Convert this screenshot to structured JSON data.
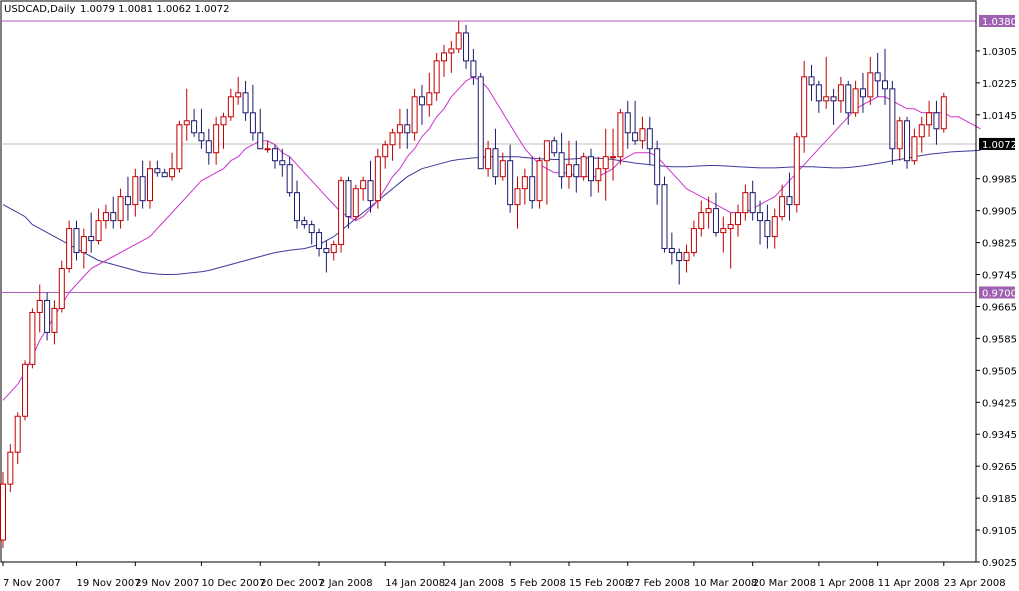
{
  "header": {
    "symbol": "USDCAD,Daily",
    "ohlc": "1.0079 1.0081 1.0062 1.0072"
  },
  "colors": {
    "background": "#ffffff",
    "bull_candle": "#c00000",
    "bear_candle": "#1a1a6e",
    "fast_ma": "#cc33cc",
    "slow_ma": "#3c3c9c",
    "level_line": "#b060c0",
    "level_badge": "#a060b0",
    "price_line": "#c0c0c0",
    "axis": "#000000"
  },
  "chart_data": {
    "type": "candlestick",
    "symbol": "USDCAD",
    "timeframe": "Daily",
    "ylim": [
      0.9025,
      1.043
    ],
    "y_ticks": [
      "1.0305",
      "1.0225",
      "1.0145",
      "0.9985",
      "0.9905",
      "0.9825",
      "0.9745",
      "0.9665",
      "0.9585",
      "0.9505",
      "0.9425",
      "0.9345",
      "0.9265",
      "0.9185",
      "0.9105",
      "0.9025"
    ],
    "x_ticks": [
      {
        "index": 0,
        "label": "7 Nov 2007"
      },
      {
        "index": 10,
        "label": "19 Nov 2007"
      },
      {
        "index": 18,
        "label": "29 Nov 2007"
      },
      {
        "index": 27,
        "label": "10 Dec 2007"
      },
      {
        "index": 35,
        "label": "20 Dec 2007"
      },
      {
        "index": 43,
        "label": "2 Jan 2008"
      },
      {
        "index": 52,
        "label": "14 Jan 2008"
      },
      {
        "index": 60,
        "label": "24 Jan 2008"
      },
      {
        "index": 69,
        "label": "5 Feb 2008"
      },
      {
        "index": 77,
        "label": "15 Feb 2008"
      },
      {
        "index": 85,
        "label": "27 Feb 2008"
      },
      {
        "index": 94,
        "label": "10 Mar 2008"
      },
      {
        "index": 102,
        "label": "20 Mar 2008"
      },
      {
        "index": 111,
        "label": "1 Apr 2008"
      },
      {
        "index": 119,
        "label": "11 Apr 2008"
      },
      {
        "index": 128,
        "label": "23 Apr 2008"
      }
    ],
    "levels": [
      {
        "value": 1.038,
        "label": "1.0380"
      },
      {
        "value": 0.97,
        "label": "0.9700"
      }
    ],
    "current_price": {
      "value": 1.0072,
      "label": "1.0072"
    },
    "candles": [
      [
        0.908,
        0.925,
        0.906,
        0.922
      ],
      [
        0.922,
        0.932,
        0.92,
        0.93
      ],
      [
        0.93,
        0.94,
        0.927,
        0.939
      ],
      [
        0.939,
        0.953,
        0.938,
        0.952
      ],
      [
        0.952,
        0.966,
        0.951,
        0.965
      ],
      [
        0.965,
        0.972,
        0.96,
        0.968
      ],
      [
        0.968,
        0.97,
        0.958,
        0.96
      ],
      [
        0.96,
        0.968,
        0.957,
        0.966
      ],
      [
        0.966,
        0.978,
        0.965,
        0.976
      ],
      [
        0.976,
        0.988,
        0.975,
        0.986
      ],
      [
        0.986,
        0.988,
        0.978,
        0.98
      ],
      [
        0.98,
        0.986,
        0.976,
        0.984
      ],
      [
        0.984,
        0.99,
        0.98,
        0.983
      ],
      [
        0.983,
        0.991,
        0.982,
        0.988
      ],
      [
        0.988,
        0.992,
        0.986,
        0.99
      ],
      [
        0.99,
        0.994,
        0.986,
        0.988
      ],
      [
        0.988,
        0.996,
        0.986,
        0.994
      ],
      [
        0.994,
        0.999,
        0.988,
        0.992
      ],
      [
        0.992,
        1.001,
        0.989,
        0.999
      ],
      [
        0.999,
        1.003,
        0.991,
        0.993
      ],
      [
        0.993,
        1.003,
        0.991,
        1.001
      ],
      [
        1.001,
        1.003,
        0.999,
        1.0
      ],
      [
        1.0,
        1.001,
        0.999,
        0.999
      ],
      [
        0.999,
        1.005,
        0.998,
        1.001
      ],
      [
        1.001,
        1.013,
        1.0,
        1.012
      ],
      [
        1.012,
        1.021,
        1.008,
        1.013
      ],
      [
        1.013,
        1.016,
        1.009,
        1.01
      ],
      [
        1.01,
        1.016,
        1.006,
        1.008
      ],
      [
        1.008,
        1.011,
        1.002,
        1.005
      ],
      [
        1.005,
        1.014,
        1.002,
        1.012
      ],
      [
        1.012,
        1.015,
        1.006,
        1.014
      ],
      [
        1.014,
        1.021,
        1.013,
        1.019
      ],
      [
        1.019,
        1.024,
        1.017,
        1.02
      ],
      [
        1.02,
        1.023,
        1.013,
        1.015
      ],
      [
        1.015,
        1.022,
        1.008,
        1.01
      ],
      [
        1.01,
        1.016,
        1.006,
        1.006
      ],
      [
        1.006,
        1.008,
        1.005,
        1.006
      ],
      [
        1.006,
        1.007,
        1.001,
        1.003
      ],
      [
        1.003,
        1.006,
        0.999,
        1.002
      ],
      [
        1.002,
        1.004,
        0.994,
        0.995
      ],
      [
        0.995,
        0.998,
        0.986,
        0.988
      ],
      [
        0.988,
        0.989,
        0.986,
        0.987
      ],
      [
        0.987,
        0.988,
        0.982,
        0.985
      ],
      [
        0.985,
        0.986,
        0.979,
        0.981
      ],
      [
        0.981,
        0.983,
        0.975,
        0.98
      ],
      [
        0.98,
        0.983,
        0.978,
        0.982
      ],
      [
        0.982,
        0.999,
        0.98,
        0.998
      ],
      [
        0.998,
        0.999,
        0.986,
        0.989
      ],
      [
        0.989,
        0.997,
        0.988,
        0.996
      ],
      [
        0.996,
        0.999,
        0.993,
        0.998
      ],
      [
        0.998,
        1.003,
        0.99,
        0.993
      ],
      [
        0.993,
        1.006,
        0.991,
        1.004
      ],
      [
        1.004,
        1.008,
        1.001,
        1.007
      ],
      [
        1.007,
        1.011,
        1.003,
        1.01
      ],
      [
        1.01,
        1.016,
        1.006,
        1.012
      ],
      [
        1.012,
        1.016,
        1.006,
        1.01
      ],
      [
        1.01,
        1.021,
        1.008,
        1.019
      ],
      [
        1.019,
        1.022,
        1.012,
        1.017
      ],
      [
        1.017,
        1.025,
        1.014,
        1.02
      ],
      [
        1.02,
        1.03,
        1.018,
        1.028
      ],
      [
        1.028,
        1.032,
        1.024,
        1.03
      ],
      [
        1.03,
        1.033,
        1.025,
        1.031
      ],
      [
        1.031,
        1.038,
        1.03,
        1.035
      ],
      [
        1.035,
        1.037,
        1.026,
        1.028
      ],
      [
        1.028,
        1.031,
        1.022,
        1.024
      ],
      [
        1.024,
        1.025,
        1.001,
        1.001
      ],
      [
        1.001,
        1.008,
        0.999,
        1.006
      ],
      [
        1.006,
        1.011,
        0.997,
        0.999
      ],
      [
        0.999,
        1.005,
        0.998,
        1.003
      ],
      [
        1.003,
        1.007,
        0.99,
        0.992
      ],
      [
        0.992,
        0.999,
        0.986,
        0.996
      ],
      [
        0.996,
        1.001,
        0.992,
        0.999
      ],
      [
        0.999,
        1.004,
        0.991,
        0.993
      ],
      [
        0.993,
        1.004,
        0.991,
        1.003
      ],
      [
        1.003,
        1.008,
        0.992,
        1.008
      ],
      [
        1.008,
        1.009,
        1.004,
        1.005
      ],
      [
        1.005,
        1.01,
        0.996,
        0.999
      ],
      [
        0.999,
        1.008,
        0.996,
        1.002
      ],
      [
        1.002,
        1.008,
        0.995,
        0.999
      ],
      [
        0.999,
        1.005,
        0.998,
        1.004
      ],
      [
        1.004,
        1.006,
        0.994,
        0.998
      ],
      [
        0.998,
        1.004,
        0.995,
        1.001
      ],
      [
        1.001,
        1.011,
        0.993,
        1.004
      ],
      [
        1.004,
        1.011,
        0.998,
        1.004
      ],
      [
        1.004,
        1.016,
        1.002,
        1.015
      ],
      [
        1.015,
        1.018,
        1.006,
        1.01
      ],
      [
        1.01,
        1.018,
        1.007,
        1.008
      ],
      [
        1.008,
        1.014,
        1.006,
        1.011
      ],
      [
        1.011,
        1.014,
        1.002,
        1.006
      ],
      [
        1.006,
        1.008,
        0.992,
        0.997
      ],
      [
        0.997,
        0.999,
        0.98,
        0.981
      ],
      [
        0.981,
        0.985,
        0.977,
        0.98
      ],
      [
        0.98,
        0.981,
        0.972,
        0.978
      ],
      [
        0.978,
        0.982,
        0.975,
        0.98
      ],
      [
        0.98,
        0.988,
        0.979,
        0.986
      ],
      [
        0.986,
        0.993,
        0.984,
        0.99
      ],
      [
        0.99,
        0.994,
        0.986,
        0.991
      ],
      [
        0.991,
        0.995,
        0.984,
        0.985
      ],
      [
        0.985,
        0.989,
        0.98,
        0.986
      ],
      [
        0.986,
        0.99,
        0.976,
        0.987
      ],
      [
        0.987,
        0.992,
        0.984,
        0.99
      ],
      [
        0.99,
        0.997,
        0.988,
        0.995
      ],
      [
        0.995,
        0.998,
        0.988,
        0.99
      ],
      [
        0.99,
        0.993,
        0.982,
        0.988
      ],
      [
        0.988,
        0.992,
        0.981,
        0.984
      ],
      [
        0.984,
        0.991,
        0.981,
        0.989
      ],
      [
        0.989,
        0.997,
        0.988,
        0.994
      ],
      [
        0.994,
        1.0,
        0.988,
        0.992
      ],
      [
        0.992,
        1.01,
        0.99,
        1.009
      ],
      [
        1.009,
        1.028,
        1.005,
        1.024
      ],
      [
        1.024,
        1.027,
        1.018,
        1.022
      ],
      [
        1.022,
        1.023,
        1.015,
        1.018
      ],
      [
        1.018,
        1.029,
        1.016,
        1.019
      ],
      [
        1.019,
        1.021,
        1.012,
        1.018
      ],
      [
        1.018,
        1.024,
        1.015,
        1.022
      ],
      [
        1.022,
        1.023,
        1.012,
        1.015
      ],
      [
        1.015,
        1.023,
        1.014,
        1.021
      ],
      [
        1.021,
        1.025,
        1.015,
        1.019
      ],
      [
        1.019,
        1.029,
        1.017,
        1.025
      ],
      [
        1.025,
        1.03,
        1.019,
        1.023
      ],
      [
        1.023,
        1.031,
        1.017,
        1.021
      ],
      [
        1.021,
        1.023,
        1.002,
        1.006
      ],
      [
        1.006,
        1.014,
        1.003,
        1.013
      ],
      [
        1.013,
        1.014,
        1.001,
        1.003
      ],
      [
        1.003,
        1.011,
        1.002,
        1.009
      ],
      [
        1.009,
        1.014,
        1.005,
        1.012
      ],
      [
        1.012,
        1.018,
        1.009,
        1.015
      ],
      [
        1.015,
        1.018,
        1.007,
        1.011
      ],
      [
        1.011,
        1.02,
        1.01,
        1.019
      ]
    ],
    "fast_ma": [
      0.943,
      0.945,
      0.947,
      0.95,
      0.954,
      0.958,
      0.961,
      0.964,
      0.967,
      0.97,
      0.972,
      0.974,
      0.976,
      0.977,
      0.978,
      0.979,
      0.98,
      0.981,
      0.982,
      0.983,
      0.984,
      0.986,
      0.988,
      0.99,
      0.992,
      0.994,
      0.996,
      0.998,
      0.999,
      1.0,
      1.001,
      1.003,
      1.004,
      1.006,
      1.007,
      1.008,
      1.008,
      1.007,
      1.005,
      1.004,
      1.002,
      1.0,
      0.998,
      0.996,
      0.994,
      0.992,
      0.99,
      0.989,
      0.988,
      0.989,
      0.991,
      0.993,
      0.996,
      0.999,
      1.001,
      1.004,
      1.006,
      1.009,
      1.011,
      1.014,
      1.016,
      1.019,
      1.021,
      1.023,
      1.024,
      1.023,
      1.021,
      1.018,
      1.015,
      1.012,
      1.009,
      1.006,
      1.004,
      1.002,
      1.001,
      1.0,
      1.0,
      1.0,
      0.999,
      0.999,
      0.999,
      0.999,
      1.0,
      1.001,
      1.003,
      1.004,
      1.005,
      1.005,
      1.005,
      1.004,
      1.002,
      1.0,
      0.998,
      0.996,
      0.995,
      0.994,
      0.993,
      0.992,
      0.991,
      0.99,
      0.99,
      0.99,
      0.991,
      0.992,
      0.993,
      0.994,
      0.996,
      0.998,
      1.0,
      1.002,
      1.004,
      1.006,
      1.008,
      1.01,
      1.012,
      1.014,
      1.016,
      1.017,
      1.018,
      1.019,
      1.019,
      1.018,
      1.017,
      1.016,
      1.016,
      1.015,
      1.015,
      1.015,
      1.015,
      1.014,
      1.014,
      1.013,
      1.012,
      1.011
    ],
    "slow_ma": [
      0.992,
      0.991,
      0.99,
      0.989,
      0.987,
      0.986,
      0.985,
      0.984,
      0.983,
      0.982,
      0.981,
      0.98,
      0.979,
      0.978,
      0.9775,
      0.977,
      0.9765,
      0.976,
      0.9755,
      0.975,
      0.9748,
      0.9746,
      0.9745,
      0.9745,
      0.9746,
      0.9748,
      0.975,
      0.9752,
      0.9755,
      0.976,
      0.9765,
      0.977,
      0.9775,
      0.978,
      0.9785,
      0.979,
      0.9795,
      0.98,
      0.9803,
      0.9806,
      0.9808,
      0.981,
      0.9815,
      0.982,
      0.983,
      0.984,
      0.9855,
      0.987,
      0.9885,
      0.99,
      0.9915,
      0.993,
      0.9945,
      0.996,
      0.9975,
      0.999,
      1.0,
      1.001,
      1.0015,
      1.002,
      1.0025,
      1.003,
      1.0033,
      1.0035,
      1.0037,
      1.0038,
      1.004,
      1.004,
      1.004,
      1.004,
      1.004,
      1.0038,
      1.0036,
      1.0035,
      1.0034,
      1.0033,
      1.0033,
      1.0034,
      1.0035,
      1.0036,
      1.0037,
      1.0036,
      1.0035,
      1.0033,
      1.003,
      1.0027,
      1.0024,
      1.0022,
      1.002,
      1.0018,
      1.0016,
      1.0015,
      1.0015,
      1.0015,
      1.0016,
      1.0017,
      1.0018,
      1.0018,
      1.0017,
      1.0016,
      1.0015,
      1.0014,
      1.0013,
      1.0012,
      1.0012,
      1.0012,
      1.0013,
      1.0014,
      1.0015,
      1.0015,
      1.0015,
      1.0014,
      1.0013,
      1.0012,
      1.0012,
      1.0013,
      1.0015,
      1.0017,
      1.002,
      1.0023,
      1.0026,
      1.003,
      1.0033,
      1.0036,
      1.004,
      1.0043,
      1.0046,
      1.0048,
      1.005,
      1.0052,
      1.0053,
      1.0054,
      1.0055,
      1.0056
    ]
  }
}
